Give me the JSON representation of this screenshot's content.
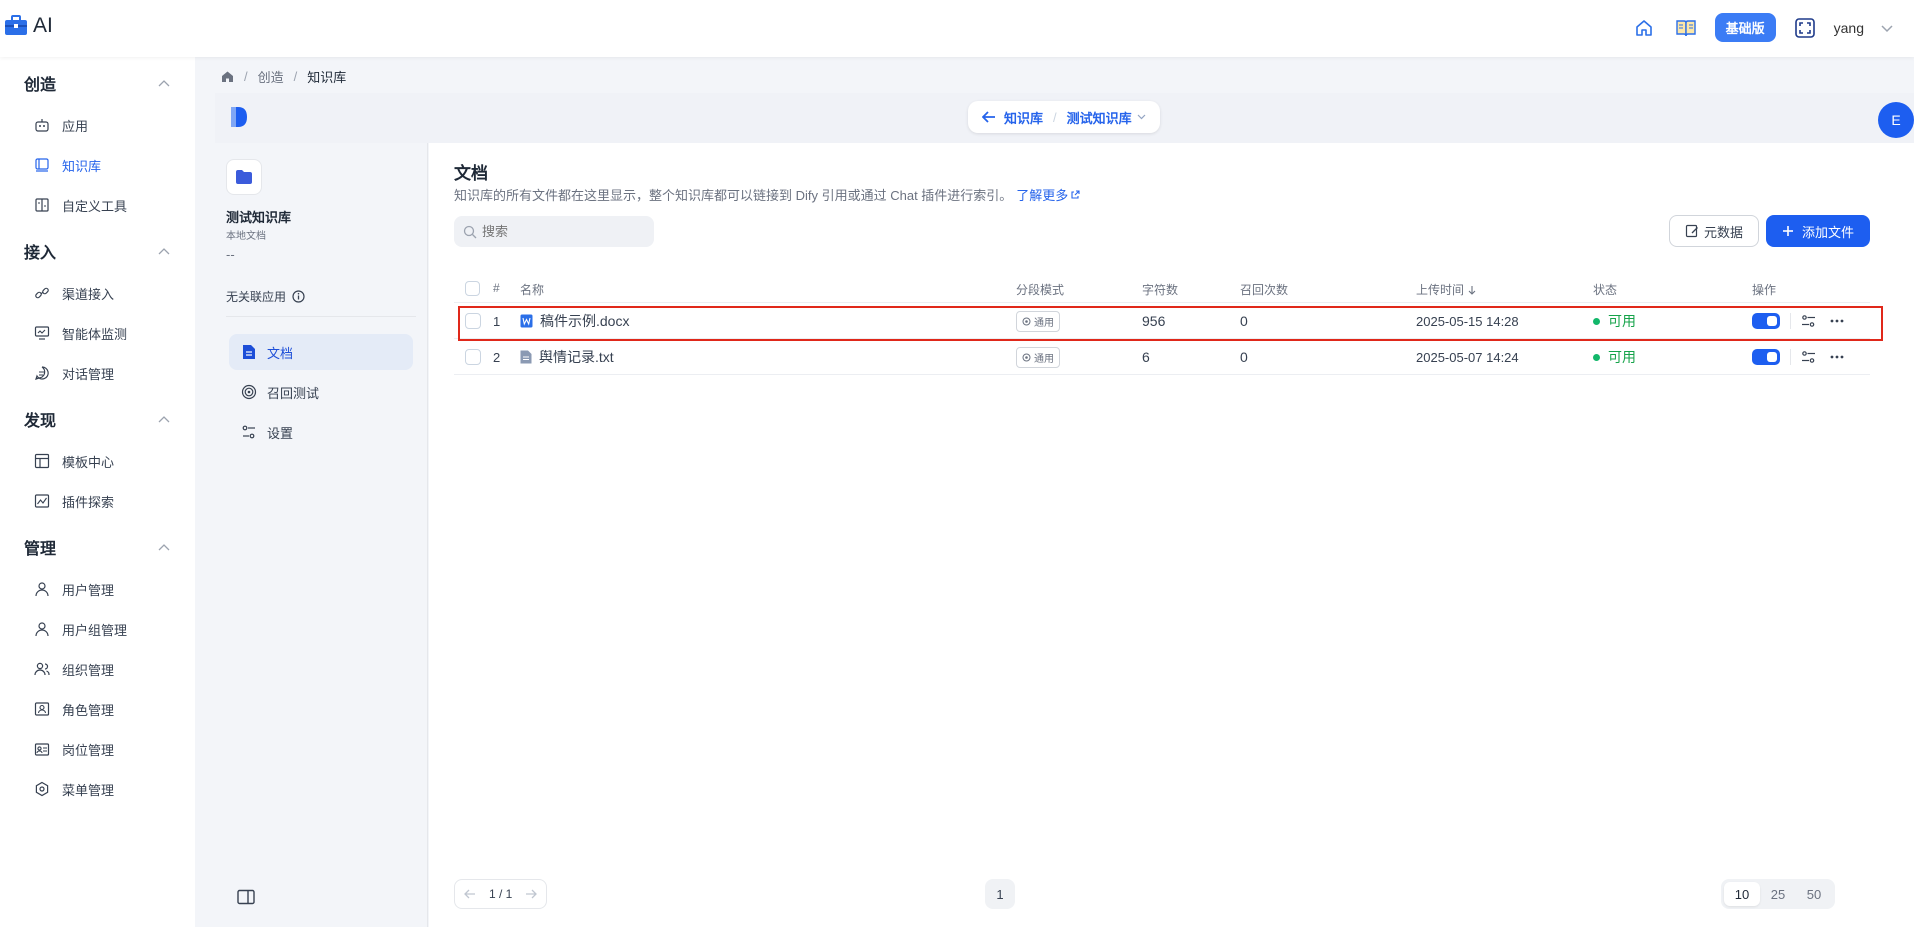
{
  "app": {
    "logo_text": "AI"
  },
  "topbar": {
    "edition_badge": "基础版",
    "username": "yang"
  },
  "sidebar": {
    "groups": [
      {
        "title": "创造",
        "items": [
          {
            "label": "应用"
          },
          {
            "label": "知识库"
          },
          {
            "label": "自定义工具"
          }
        ]
      },
      {
        "title": "接入",
        "items": [
          {
            "label": "渠道接入"
          },
          {
            "label": "智能体监测"
          },
          {
            "label": "对话管理"
          }
        ]
      },
      {
        "title": "发现",
        "items": [
          {
            "label": "模板中心"
          },
          {
            "label": "插件探索"
          }
        ]
      },
      {
        "title": "管理",
        "items": [
          {
            "label": "用户管理"
          },
          {
            "label": "用户组管理"
          },
          {
            "label": "组织管理"
          },
          {
            "label": "角色管理"
          },
          {
            "label": "岗位管理"
          },
          {
            "label": "菜单管理"
          }
        ]
      }
    ]
  },
  "breadcrumb": {
    "items": [
      "创造",
      "知识库"
    ],
    "separator": "/"
  },
  "dataset_switcher": {
    "back_label": "知识库",
    "separator": "/",
    "current": "测试知识库"
  },
  "user_avatar": {
    "initial": "E"
  },
  "knowledge": {
    "name": "测试知识库",
    "type": "本地文档",
    "description": "--",
    "unlinked_label": "无关联应用",
    "nav": [
      {
        "label": "文档"
      },
      {
        "label": "召回测试"
      },
      {
        "label": "设置"
      }
    ]
  },
  "documents": {
    "title": "文档",
    "description": "知识库的所有文件都在这里显示，整个知识库都可以链接到 Dify 引用或通过 Chat 插件进行索引。",
    "learn_more": "了解更多",
    "search_placeholder": "搜索",
    "metadata_button": "元数据",
    "add_button": "添加文件",
    "columns": {
      "index": "#",
      "name": "名称",
      "mode": "分段模式",
      "chars": "字符数",
      "hits": "召回次数",
      "upload_time": "上传时间",
      "status": "状态",
      "action": "操作"
    },
    "rows": [
      {
        "index": "1",
        "name": "稿件示例.docx",
        "mode": "通用",
        "chars": "956",
        "hits": "0",
        "upload_time": "2025-05-15 14:28",
        "status": "可用",
        "enabled": true,
        "highlighted": true
      },
      {
        "index": "2",
        "name": "舆情记录.txt",
        "mode": "通用",
        "chars": "6",
        "hits": "0",
        "upload_time": "2025-05-07 14:24",
        "status": "可用",
        "enabled": true,
        "highlighted": false
      }
    ]
  },
  "pagination": {
    "indicator": "1 / 1",
    "current_page": "1",
    "page_sizes": [
      "10",
      "25",
      "50"
    ],
    "selected_size": "10"
  },
  "colors": {
    "accent": "#1d5ef0",
    "status_ok": "#12b76a",
    "highlight_border": "#e0281a"
  }
}
